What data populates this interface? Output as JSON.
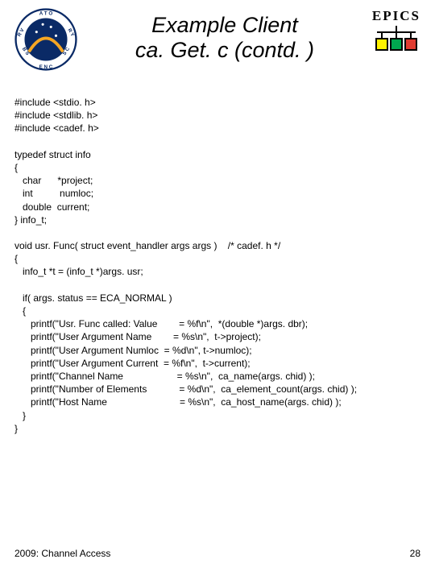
{
  "header": {
    "title_line1": "Example Client",
    "title_line2": "ca. Get. c (contd. )",
    "epics_label": "EPICS"
  },
  "code": "#include <stdio. h>\n#include <stdlib. h>\n#include <cadef. h>\n\ntypedef struct info\n{\n   char      *project;\n   int          numloc;\n   double  current;\n} info_t;\n\nvoid usr. Func( struct event_handler args args )    /* cadef. h */\n{\n   info_t *t = (info_t *)args. usr;\n\n   if( args. status == ECA_NORMAL )\n   {\n      printf(\"Usr. Func called: Value        = %f\\n\",  *(double *)args. dbr);\n      printf(\"User Argument Name        = %s\\n\",  t->project);\n      printf(\"User Argument Numloc  = %d\\n\", t->numloc);\n      printf(\"User Argument Current  = %f\\n\",  t->current);\n      printf(\"Channel Name                    = %s\\n\",  ca_name(args. chid) );\n      printf(\"Number of Elements            = %d\\n\",  ca_element_count(args. chid) );\n      printf(\"Host Name                           = %s\\n\",  ca_host_name(args. chid) );\n   }\n}",
  "footer": {
    "left": "2009: Channel Access",
    "right": "28"
  }
}
